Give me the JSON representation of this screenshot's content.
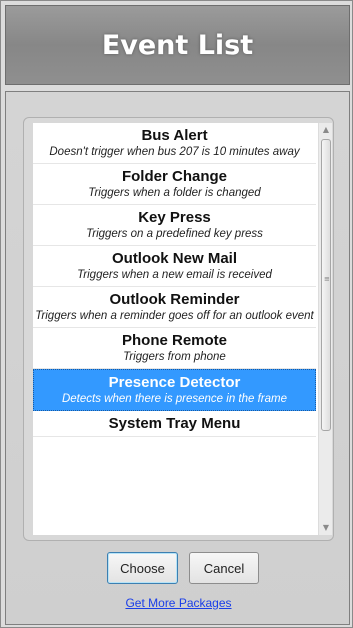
{
  "window": {
    "title": "Event List"
  },
  "events": [
    {
      "title": "Bus Alert",
      "desc": "Doesn't trigger when bus 207 is 10 minutes away"
    },
    {
      "title": "Folder Change",
      "desc": "Triggers when a folder is changed"
    },
    {
      "title": "Key Press",
      "desc": "Triggers on a predefined key press"
    },
    {
      "title": "Outlook New Mail",
      "desc": "Triggers when a new email is received"
    },
    {
      "title": "Outlook Reminder",
      "desc": "Triggers when a reminder goes off for an outlook event"
    },
    {
      "title": "Phone Remote",
      "desc": "Triggers from phone"
    },
    {
      "title": "Presence Detector",
      "desc": "Detects when there is presence in the frame"
    },
    {
      "title": "System Tray Menu",
      "desc": ""
    }
  ],
  "selected_index": 6,
  "buttons": {
    "choose": "Choose",
    "cancel": "Cancel"
  },
  "link": {
    "more_packages": "Get More Packages"
  },
  "colors": {
    "selection": "#3399ff",
    "link": "#1a3ee8"
  }
}
